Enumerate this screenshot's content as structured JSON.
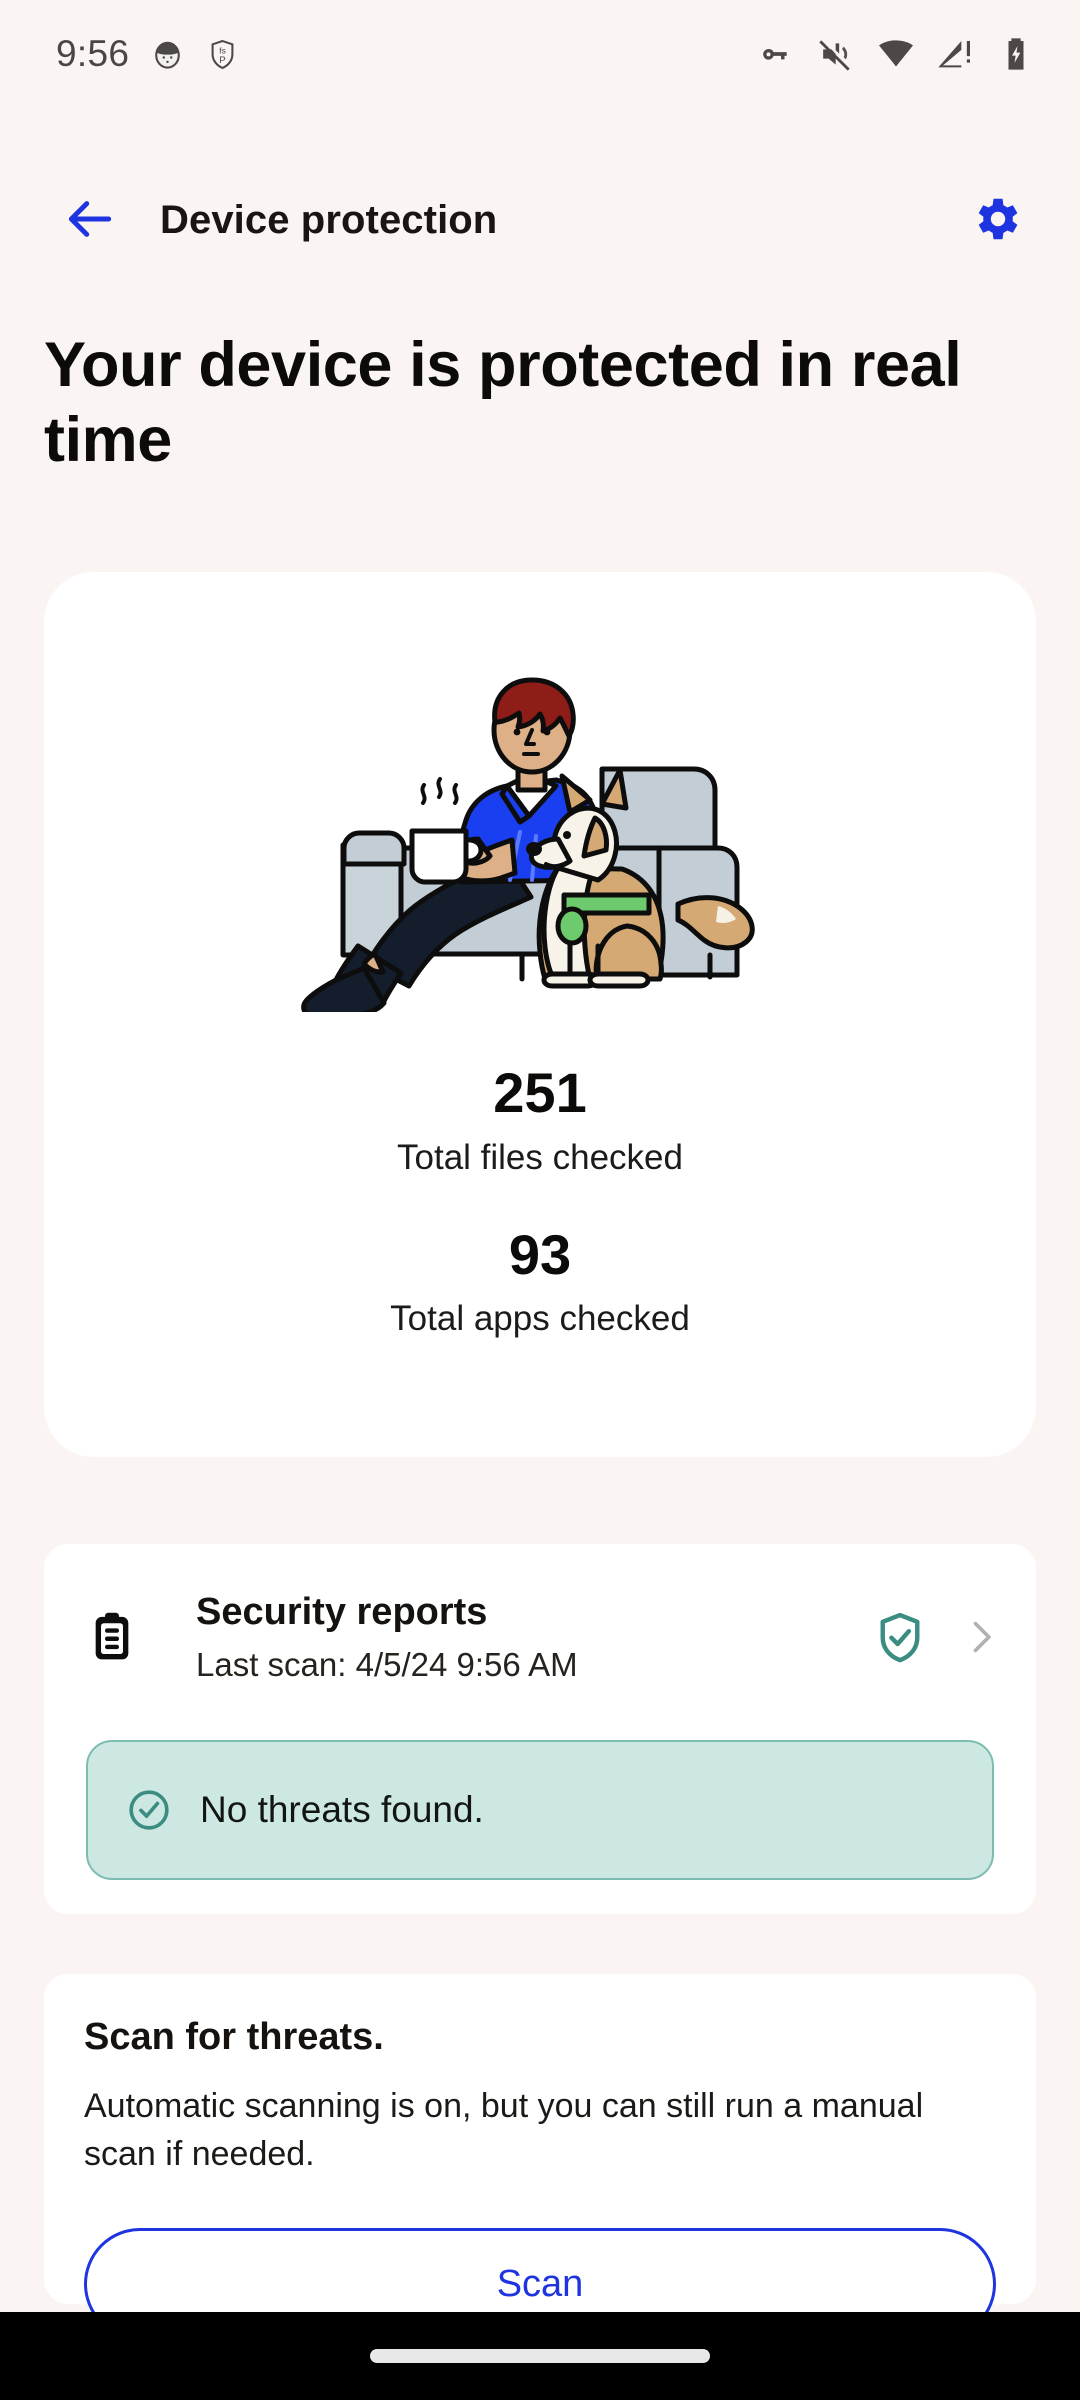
{
  "status_bar": {
    "clock": "9:56",
    "left_icons": [
      "face-app-icon",
      "fsp-shield-app-icon"
    ],
    "right_icons": [
      "vpn-key-icon",
      "sound-muted-icon",
      "wifi-icon",
      "no-sim-signal-icon",
      "battery-charging-icon"
    ]
  },
  "app_bar": {
    "back_icon": "back-arrow-icon",
    "title": "Device protection",
    "settings_icon": "gear-icon"
  },
  "headline": "Your device is protected in real time",
  "illustration": {
    "name": "person-on-couch-with-dog-illustration",
    "colors": {
      "hair": "#8e1d18",
      "skin": "#deb087",
      "shirt": "#1a3ff0",
      "pants": "#131d2b",
      "couch": "#c3cdd6",
      "dog_fur": "#d5a974",
      "dog_collar": "#6dcb6d",
      "mug": "#ffffff"
    }
  },
  "stats": [
    {
      "value": "251",
      "label": "Total files checked"
    },
    {
      "value": "93",
      "label": "Total apps checked"
    }
  ],
  "security_reports": {
    "icon": "clipboard-icon",
    "title": "Security reports",
    "subtitle": "Last scan: 4/5/24 9:56 AM",
    "status_icon": "shield-check-icon",
    "chevron_icon": "chevron-right-icon",
    "banner": {
      "icon": "check-circle-icon",
      "text": "No threats found."
    }
  },
  "scan_section": {
    "title": "Scan for threats.",
    "description": "Automatic scanning is on, but you can still run a manual scan if needed.",
    "button_label": "Scan"
  },
  "colors": {
    "background": "#faf4f2",
    "card": "#ffffff",
    "accent_blue": "#1e34e0",
    "teal": "#3c8d81",
    "banner_fill": "#cde8e2",
    "banner_border": "#7cbcb1",
    "nav_bar": "#000000"
  }
}
